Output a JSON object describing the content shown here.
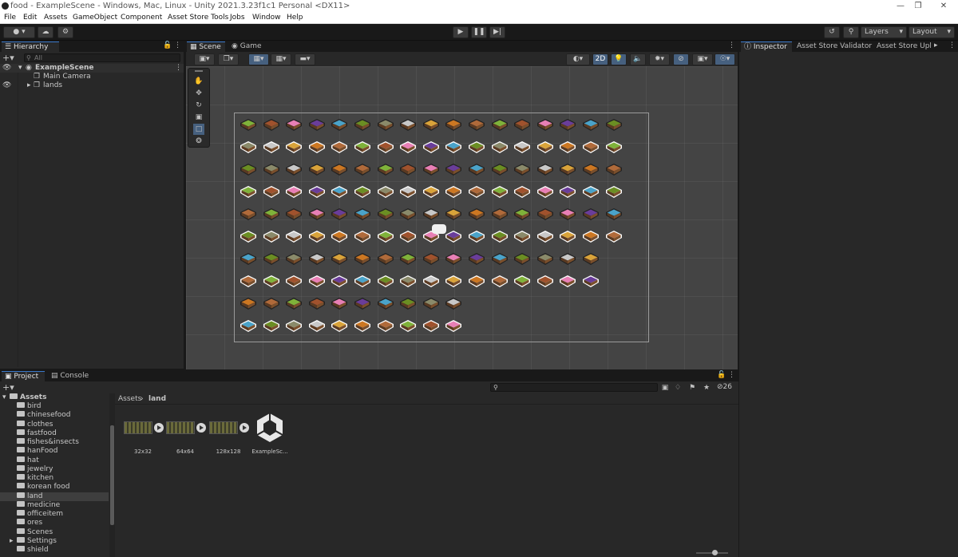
{
  "window": {
    "title": "food - ExampleScene - Windows, Mac, Linux - Unity 2021.3.23f1c1 Personal <DX11>",
    "controls": [
      "—",
      "❐",
      "✕"
    ]
  },
  "menu": [
    "File",
    "Edit",
    "Assets",
    "GameObject",
    "Component",
    "Asset Store Tools",
    "Jobs",
    "Window",
    "Help"
  ],
  "toolbar": {
    "layers_label": "Layers",
    "layout_label": "Layout"
  },
  "hierarchy": {
    "tab": "Hierarchy",
    "search_placeholder": "All",
    "scene": "ExampleScene",
    "items": [
      "Main Camera",
      "lands"
    ]
  },
  "scene": {
    "tabs": [
      "Scene",
      "Game"
    ],
    "mode_2d": "2D"
  },
  "inspector": {
    "tabs": [
      "Inspector",
      "Asset Store Validator",
      "Asset Store Upl"
    ]
  },
  "project": {
    "tabs": [
      "Project",
      "Console"
    ],
    "root": "Assets",
    "folders": [
      "bird",
      "chinesefood",
      "clothes",
      "fastfood",
      "fishes&insects",
      "hanFood",
      "hat",
      "jewelry",
      "kitchen",
      "korean food",
      "land",
      "medicine",
      "officeitem",
      "ores",
      "Scenes",
      "Settings",
      "shield"
    ],
    "selected": "land",
    "breadcrumb_root": "Assets",
    "breadcrumb_current": "land",
    "hidden_count": "26",
    "assets": [
      "32x32",
      "64x64",
      "128x128",
      "ExampleSc..."
    ]
  },
  "colors": {
    "accent": "#3a78c9",
    "panel": "#282828",
    "scene_bg": "#444444"
  },
  "tile_palette": [
    "#7fb23a",
    "#4aa3c9",
    "#d9a33a",
    "#a0522d",
    "#6b8e23",
    "#cc7722",
    "#e87fb5",
    "#8a8a6a",
    "#b06a3a",
    "#6a3d9a",
    "#c8c8c8"
  ]
}
